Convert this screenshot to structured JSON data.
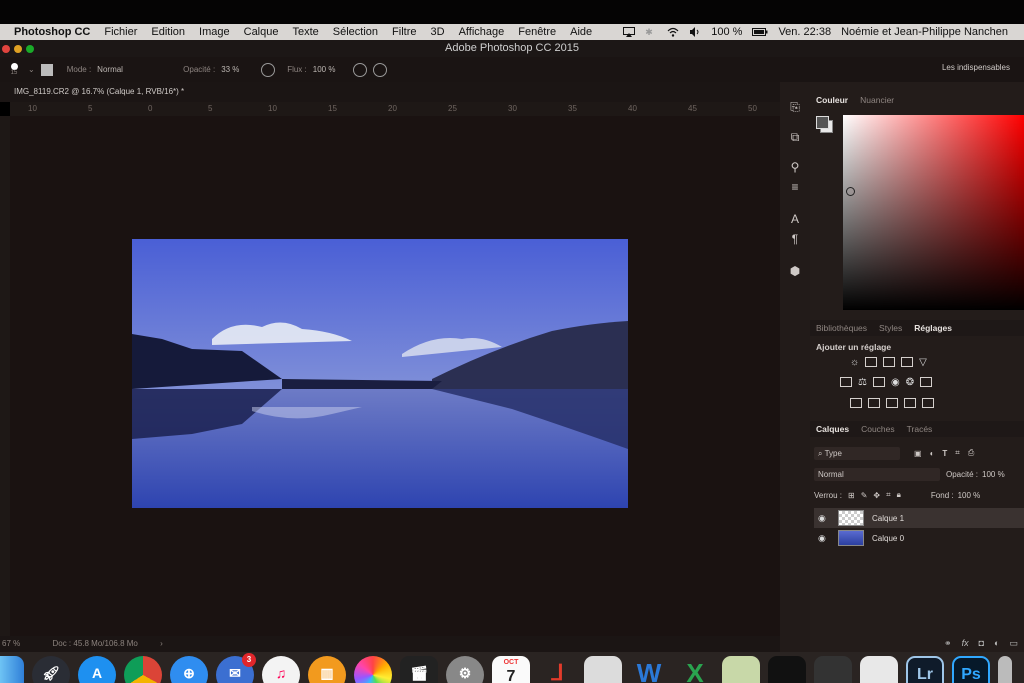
{
  "menubar": {
    "app": "Photoshop CC",
    "items": [
      "Fichier",
      "Edition",
      "Image",
      "Calque",
      "Texte",
      "Sélection",
      "Filtre",
      "3D",
      "Affichage",
      "Fenêtre",
      "Aide"
    ],
    "battery": "100 %",
    "clock": "Ven. 22:38",
    "user": "Noémie et Jean-Philippe Nanchen"
  },
  "window": {
    "title": "Adobe Photoshop CC 2015"
  },
  "options": {
    "brush_size": "15",
    "mode_label": "Mode :",
    "mode_value": "Normal",
    "opacity_label": "Opacité :",
    "opacity_value": "33 %",
    "flow_label": "Flux :",
    "flow_value": "100 %",
    "workspace": "Les indispensables"
  },
  "document": {
    "tab_title": "IMG_8119.CR2 @ 16.7% (Calque 1, RVB/16*) *",
    "ruler_ticks": [
      "10",
      "5",
      "0",
      "5",
      "10",
      "15",
      "20",
      "25",
      "30",
      "35",
      "40",
      "45",
      "50"
    ],
    "zoom": "67 %",
    "doc_info": "Doc : 45.8 Mo/106.8 Mo"
  },
  "panels": {
    "color_tabs": [
      "Couleur",
      "Nuancier"
    ],
    "library_tabs": [
      "Bibliothèques",
      "Styles",
      "Réglages"
    ],
    "add_adjustment": "Ajouter un réglage",
    "layer_tabs": [
      "Calques",
      "Couches",
      "Tracés"
    ],
    "filter_kind": "Type",
    "blend_mode": "Normal",
    "opacity_label": "Opacité :",
    "opacity_value": "100 %",
    "lock_label": "Verrou :",
    "fill_label": "Fond :",
    "fill_value": "100 %",
    "layers": [
      {
        "name": "Calque 1"
      },
      {
        "name": "Calque 0"
      }
    ],
    "footer": "fx"
  },
  "dock": {
    "mail_badge": "3",
    "calendar_month": "OCT",
    "calendar_day": "7",
    "lr_label": "Lr",
    "ps_label": "Ps"
  }
}
